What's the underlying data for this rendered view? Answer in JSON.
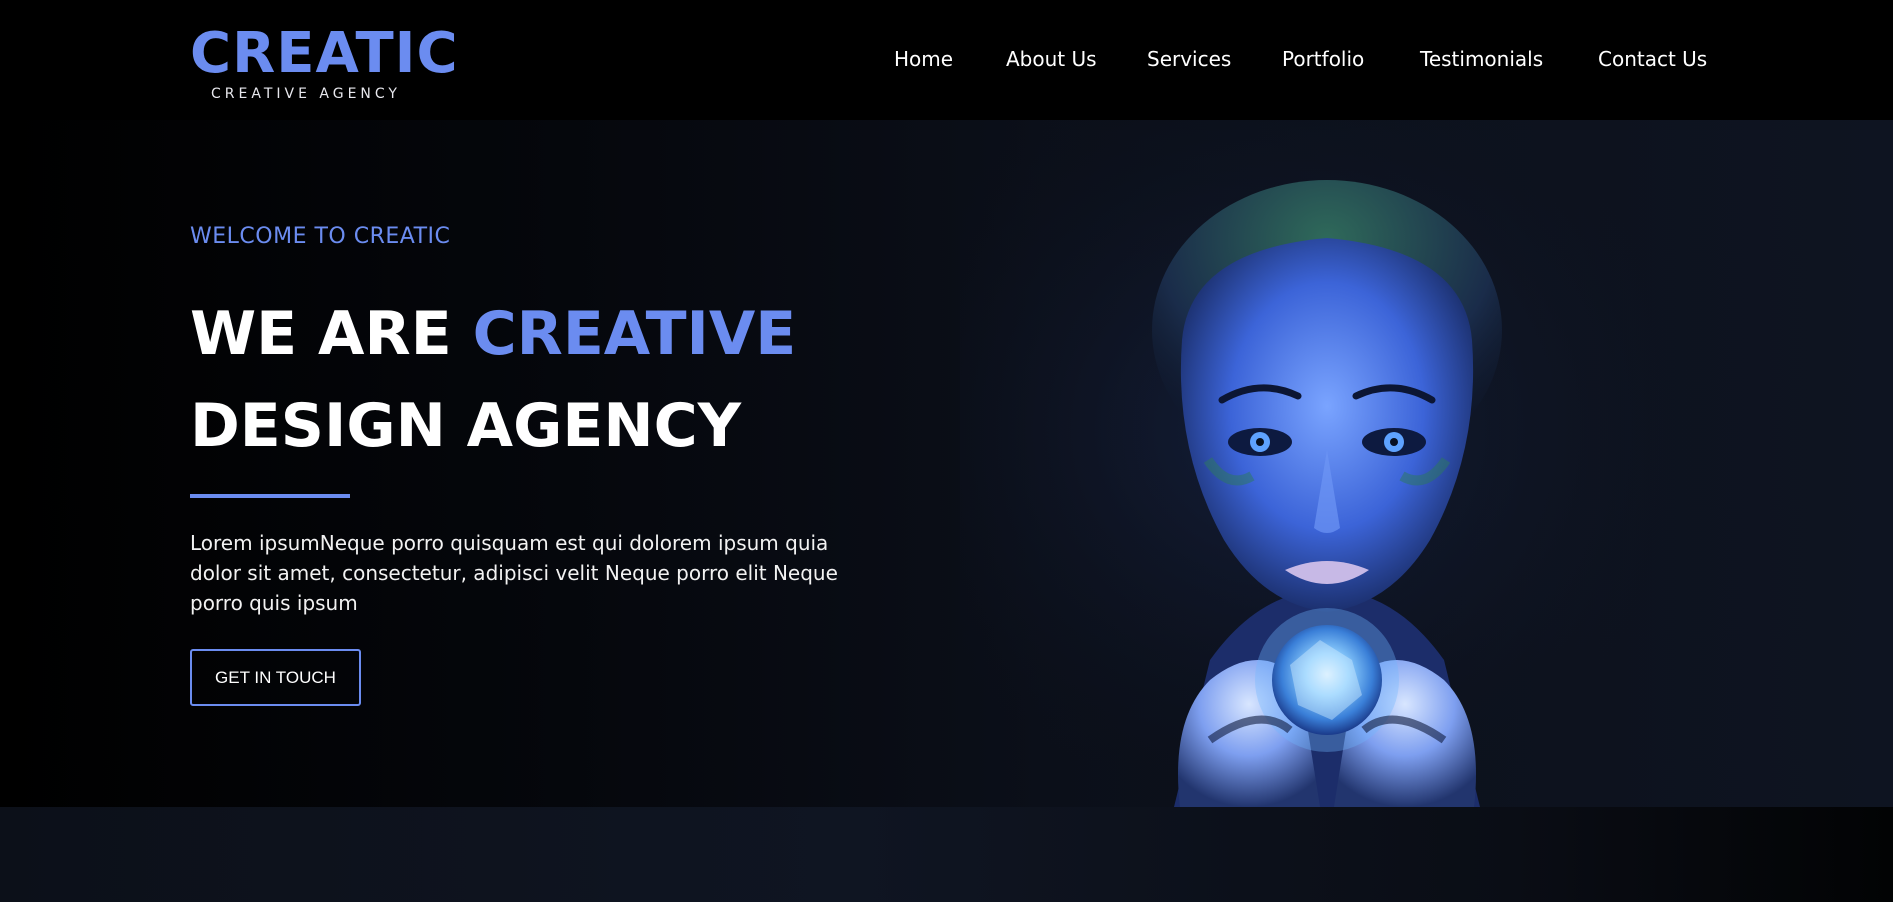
{
  "brand": {
    "name": "CREATIC",
    "tagline": "CREATIVE AGENCY",
    "accent_color": "#6b8cf0"
  },
  "nav": {
    "items": [
      {
        "label": "Home"
      },
      {
        "label": "About Us"
      },
      {
        "label": "Services"
      },
      {
        "label": "Portfolio"
      },
      {
        "label": "Testimonials"
      },
      {
        "label": "Contact Us"
      }
    ]
  },
  "hero": {
    "welcome": "WELCOME TO CREATIC",
    "headline_line1_prefix": "WE ARE ",
    "headline_line1_accent": "CREATIVE",
    "headline_line2": "DESIGN AGENCY",
    "description": "Lorem ipsumNeque porro quisquam est qui dolorem ipsum quia dolor sit amet, consectetur, adipisci velit Neque porro elit Neque porro quis ipsum",
    "cta_label": "GET IN TOUCH"
  }
}
